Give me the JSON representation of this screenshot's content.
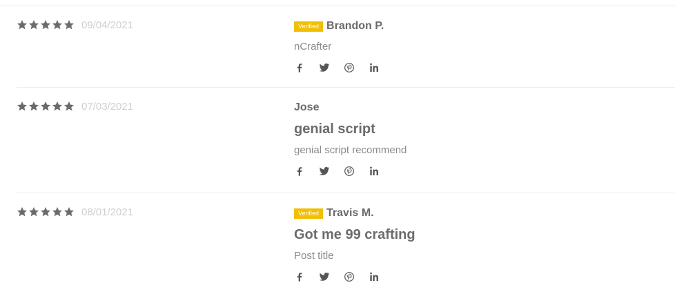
{
  "reviews": [
    {
      "rating": 5,
      "date": "09/04/2021",
      "verified": "Verified",
      "author": "Brandon P.",
      "title": "",
      "content": "nCrafter"
    },
    {
      "rating": 5,
      "date": "07/03/2021",
      "verified": "",
      "author": "Jose",
      "title": "genial script",
      "content": "genial script recommend"
    },
    {
      "rating": 5,
      "date": "08/01/2021",
      "verified": "Verified",
      "author": "Travis M.",
      "title": "Got me 99 crafting",
      "content": "Post title"
    }
  ],
  "share_icons": [
    "facebook-icon",
    "twitter-icon",
    "pinterest-icon",
    "linkedin-icon"
  ],
  "colors": {
    "badge": "#f2be00",
    "star": "#6b6b6b",
    "date": "#cfcfcf"
  }
}
